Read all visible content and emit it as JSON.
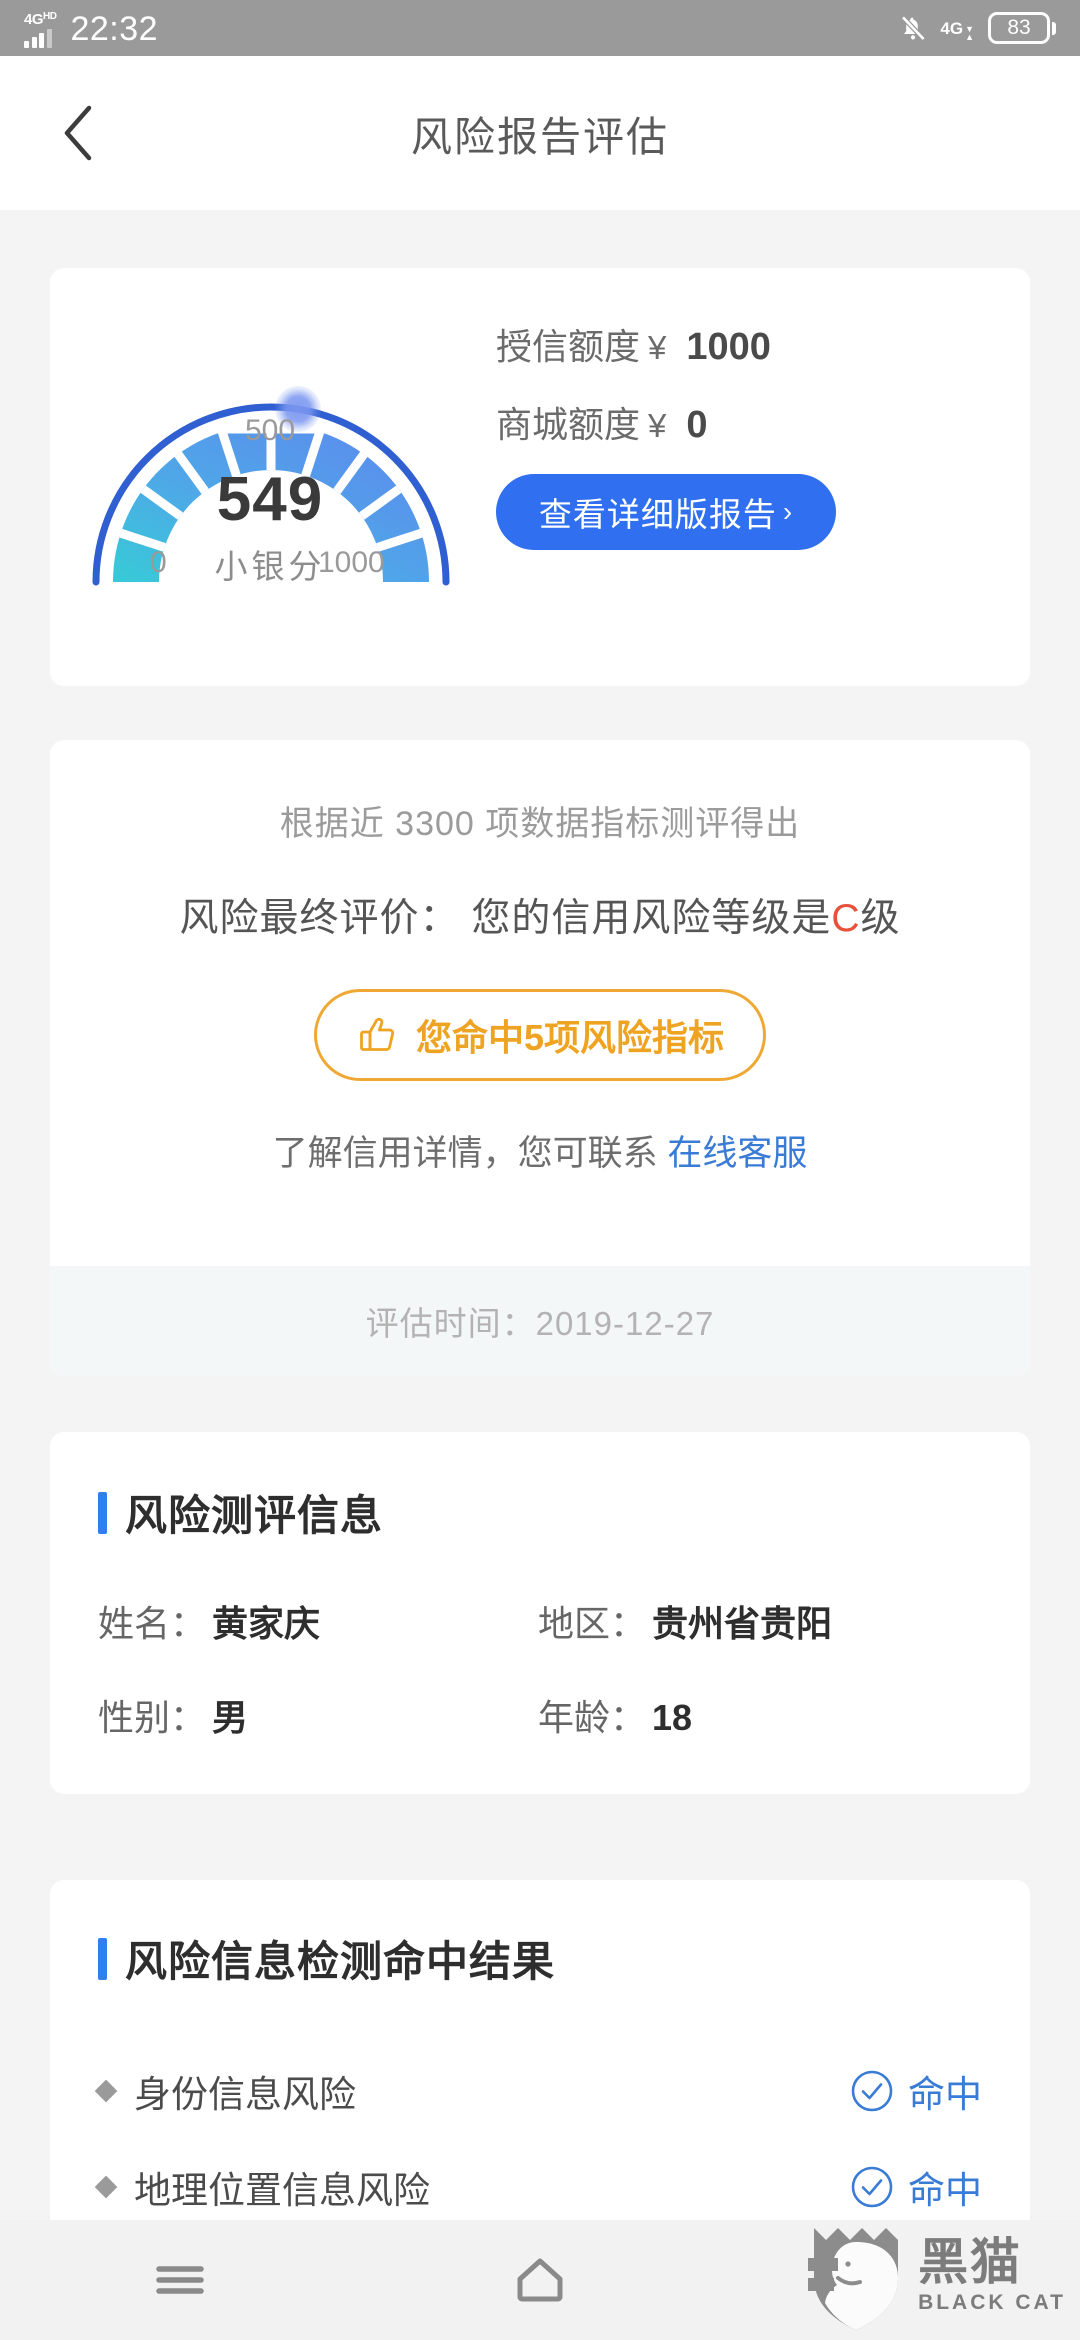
{
  "status_bar": {
    "network_label": "4G",
    "network_sup": "HD",
    "time": "22:32",
    "secondary_network": "4G",
    "battery_percent": "83",
    "icons": [
      "signal-bars-icon",
      "mute-bell-icon",
      "data-arrows-icon",
      "battery-icon"
    ]
  },
  "header": {
    "back_icon": "back-chevron-icon",
    "title": "风险报告评估"
  },
  "score_card": {
    "gauge": {
      "value": "549",
      "unit_label": "小银分",
      "tick_min": "0",
      "tick_mid": "500",
      "tick_max": "1000",
      "min": 0,
      "max": 1000,
      "indicator_color": "#7a96f0",
      "arc_start_color": "#3ec6d6",
      "arc_end_color": "#5b8ded",
      "track_color": "#2f5fd0"
    },
    "credit_limit_label": "授信额度",
    "credit_limit_currency": "¥",
    "credit_limit_value": "1000",
    "mall_limit_label": "商城额度",
    "mall_limit_currency": "¥",
    "mall_limit_value": "0",
    "detail_button": "查看详细版报告",
    "detail_button_chevron": "›"
  },
  "verdict_card": {
    "subtitle": "根据近 3300 项数据指标测评得出",
    "main_prefix": "风险最终评价：  您的信用风险等级是",
    "grade": "C",
    "main_suffix": "级",
    "grade_color": "#e8503a",
    "hit_badge": {
      "icon": "thumbs-up-icon",
      "label": "您命中5项风险指标",
      "color": "#efa322"
    },
    "link_prefix": "了解信用详情，您可联系 ",
    "link_text": "在线客服",
    "link_color": "#3a7bd5",
    "eval_time": "评估时间：2019-12-27"
  },
  "info_card": {
    "title": "风险测评信息",
    "rows": [
      [
        {
          "key": "姓名：",
          "value": "黄家庆"
        },
        {
          "key": "地区：",
          "value": "贵州省贵阳"
        }
      ],
      [
        {
          "key": "性别：",
          "value": "男"
        },
        {
          "key": "年龄：",
          "value": "18"
        }
      ]
    ]
  },
  "detect_card": {
    "title": "风险信息检测命中结果",
    "items": [
      {
        "name": "身份信息风险",
        "status": "命中",
        "icon": "check-circle-icon"
      },
      {
        "name": "地理位置信息风险",
        "status": "命中",
        "icon": "check-circle-icon"
      }
    ]
  },
  "navbar": {
    "menu_icon": "menu-icon",
    "home_icon": "home-icon"
  },
  "watermark": {
    "cn": "黑猫",
    "en": "BLACK CAT",
    "icon": "black-cat-shield-icon"
  }
}
